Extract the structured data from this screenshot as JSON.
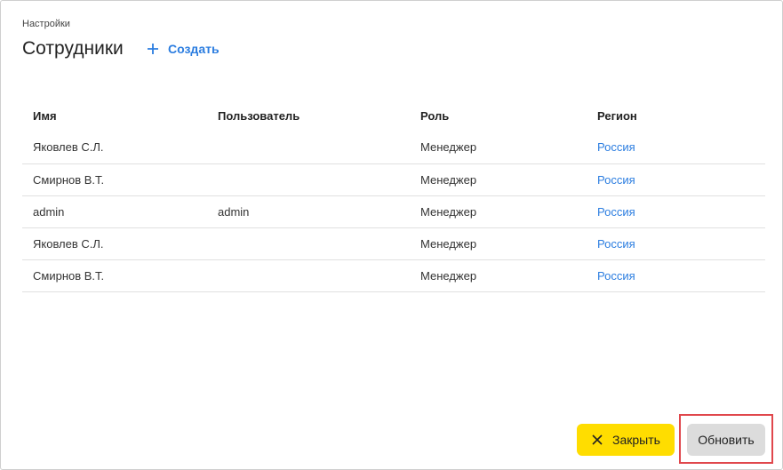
{
  "breadcrumb": "Настройки",
  "title": "Сотрудники",
  "create_label": "Создать",
  "table": {
    "columns": [
      "Имя",
      "Пользователь",
      "Роль",
      "Регион"
    ],
    "rows": [
      {
        "name": "Яковлев С.Л.",
        "user": "",
        "role": "Менеджер",
        "region": "Россия"
      },
      {
        "name": "Смирнов В.Т.",
        "user": "",
        "role": "Менеджер",
        "region": "Россия"
      },
      {
        "name": "admin",
        "user": "admin",
        "role": "Менеджер",
        "region": "Россия"
      },
      {
        "name": "Яковлев С.Л.",
        "user": "",
        "role": "Менеджер",
        "region": "Россия"
      },
      {
        "name": "Смирнов В.Т.",
        "user": "",
        "role": "Менеджер",
        "region": "Россия"
      }
    ]
  },
  "footer": {
    "close_label": "Закрыть",
    "refresh_label": "Обновить"
  },
  "colors": {
    "accent": "#2b7de0",
    "close_button_bg": "#ffdd00",
    "refresh_button_bg": "#dcdcdc",
    "highlight": "#e0474c"
  },
  "icons": {
    "create": "plus-icon",
    "close": "close-icon"
  }
}
